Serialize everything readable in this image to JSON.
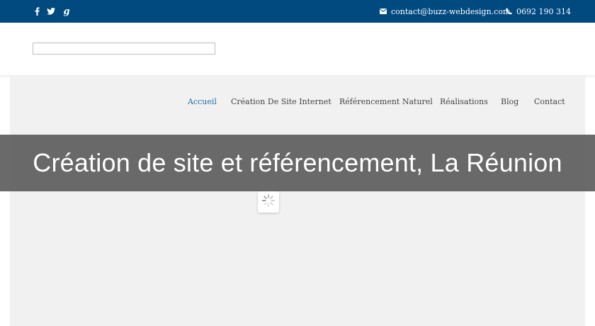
{
  "topbar": {
    "social_icons": [
      "facebook-icon",
      "twitter-icon",
      "google-plus-icon"
    ],
    "email": "contact@buzz-webdesign.com",
    "phone": "0692 190 314",
    "icons": {
      "email": "envelope-icon",
      "phone": "phone-icon"
    }
  },
  "nav": {
    "items": [
      {
        "label": "Accueil",
        "active": true
      },
      {
        "label": "Création De Site Internet",
        "active": false
      },
      {
        "label": "Référencement Naturel",
        "active": false
      },
      {
        "label": "Réalisations",
        "active": false
      },
      {
        "label": "Blog",
        "active": false
      },
      {
        "label": "Contact",
        "active": false
      }
    ]
  },
  "banner": {
    "title": "Création de site et référencement, La Réunion"
  },
  "loader": {
    "icon": "spinner-icon"
  },
  "colors": {
    "topbar_bg": "#004a80",
    "nav_active": "#1b6ea8",
    "banner_bg": "#5f5f5f",
    "content_bg": "#f1f1f1"
  }
}
